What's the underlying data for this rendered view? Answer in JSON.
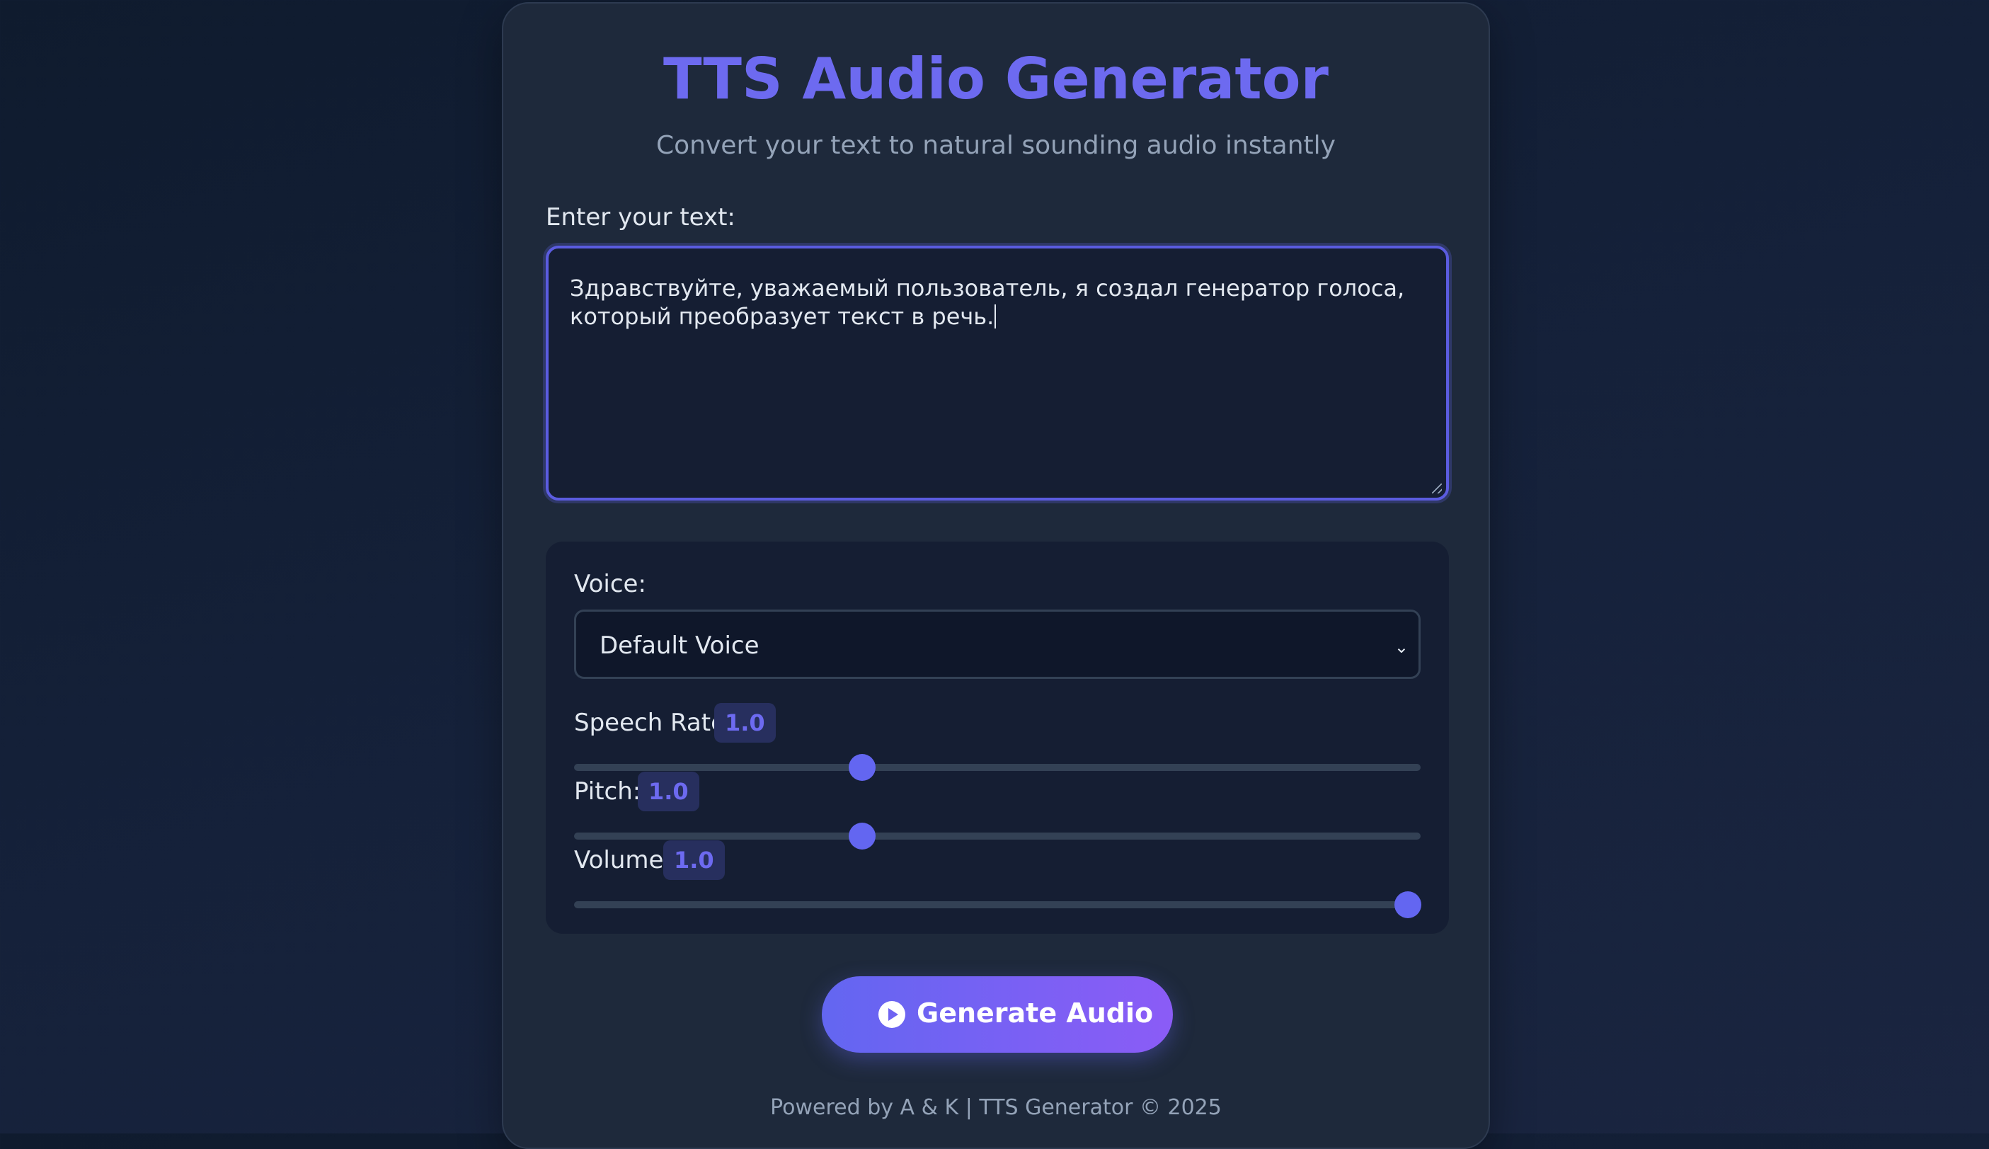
{
  "header": {
    "title": "TTS Audio Generator",
    "subtitle": "Convert your text to natural sounding audio instantly"
  },
  "text_input": {
    "label": "Enter your text:",
    "value": "Здравствуйте, уважаемый пользователь, я создал генератор голоса, который преобразует текст в речь."
  },
  "controls": {
    "voice": {
      "label": "Voice:",
      "selected": "Default Voice",
      "icon": "chevron-down-icon"
    },
    "speech_rate": {
      "label": "Speech Rate:",
      "value": "1.0",
      "slider_fraction": 0.34
    },
    "pitch": {
      "label": "Pitch:",
      "value": "1.0",
      "slider_fraction": 0.34
    },
    "volume": {
      "label": "Volume:",
      "value": "1.0",
      "slider_fraction": 0.985
    }
  },
  "generate_button": {
    "label": "Generate Audio",
    "icon": "play-circle-icon"
  },
  "footer": {
    "text": "Powered by A & K | TTS Generator © 2025"
  },
  "colors": {
    "accent": "#6366f1",
    "accent_end": "#8b5cf6",
    "title": "#6d6af0",
    "background": "#0f1b2e",
    "card": "#1e293b",
    "panel": "#151e33"
  }
}
